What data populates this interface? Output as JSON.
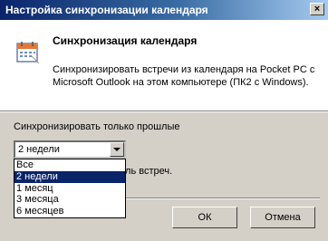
{
  "window": {
    "title": "Настройка синхронизации календаря",
    "close_glyph": "×"
  },
  "header": {
    "icon": "calendar-icon",
    "title": "Синхронизация календаря",
    "description": "Синхронизировать встречи из календаря на Pocket PC с Microsoft Outlook на этом компьютере (ПК2 с Windows)."
  },
  "sync": {
    "label": "Синхронизировать только прошлые",
    "selected": "2 недели",
    "options": [
      "Все",
      "2 недели",
      "1 месяц",
      "3 месяца",
      "6 месяцев"
    ],
    "partial_text": "едель встреч."
  },
  "buttons": {
    "ok": "ОК",
    "cancel": "Отмена"
  },
  "colors": {
    "titlebar_start": "#0a246a",
    "titlebar_end": "#a6caf0",
    "selection": "#0a246a",
    "face": "#d4d0c8"
  }
}
